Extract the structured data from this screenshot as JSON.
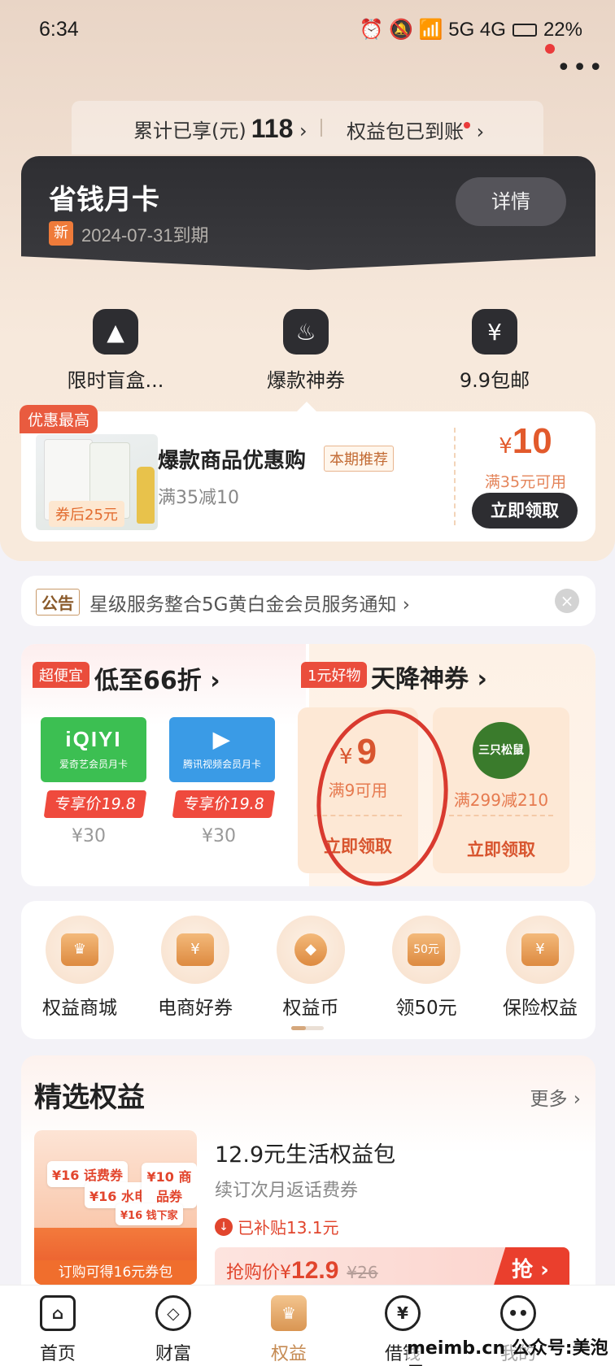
{
  "status": {
    "time": "6:34",
    "icons": "⏰ 🔕 📶 5G 4G",
    "battery": "22%"
  },
  "top": {
    "more": "•••",
    "stats_label": "累计已享(元)",
    "stats_value": "118",
    "benefit_arrived": "权益包已到账"
  },
  "card": {
    "title": "省钱月卡",
    "new_badge": "新",
    "expire": "2024-07-31到期",
    "detail_button": "详情"
  },
  "quick": [
    {
      "label": "限时盲盒...",
      "icon": "image-icon"
    },
    {
      "label": "爆款神券",
      "icon": "fire-icon"
    },
    {
      "label": "9.9包邮",
      "icon": "money-bag-icon"
    }
  ],
  "promo": {
    "tag": "优惠最高",
    "after": "券后25元",
    "title": "爆款商品优惠购",
    "recommend": "本期推荐",
    "sub": "满35减10",
    "price_symbol": "¥",
    "price": "10",
    "condition": "满35元可用",
    "claim": "立即领取"
  },
  "notice": {
    "tag": "公告",
    "text": "星级服务整合5G黄白金会员服务通知 ›",
    "close": "×"
  },
  "deals": {
    "left_pill": "超便宜",
    "left_title": "低至66折 ›",
    "right_pill": "1元好物",
    "right_title": "天降神券 ›",
    "vips": [
      {
        "logo": "iQIYI",
        "caption": "爱奇艺会员月卡",
        "exclusive": "专享价19.8",
        "orig": "¥30",
        "color": "#3cbf52"
      },
      {
        "logo": "▶",
        "caption": "腾讯视频会员月卡",
        "exclusive": "专享价19.8",
        "orig": "¥30",
        "color": "#3a9be6"
      }
    ],
    "coupons": [
      {
        "symbol": "¥",
        "value": "9",
        "cond": "满9可用",
        "btn": "立即领取"
      },
      {
        "logo": "三只松鼠",
        "cond": "满299减210",
        "btn": "立即领取"
      }
    ]
  },
  "grid": [
    {
      "label": "权益商城",
      "glyph": "♛"
    },
    {
      "label": "电商好券",
      "glyph": "¥"
    },
    {
      "label": "权益币",
      "glyph": "◆"
    },
    {
      "label": "领50元",
      "glyph": "50元"
    },
    {
      "label": "保险权益",
      "glyph": "¥"
    }
  ],
  "featured": {
    "title": "精选权益",
    "more": "更多 ›",
    "img_chips": [
      "¥16 话费券",
      "¥16 水电煤",
      "¥10 商品券",
      "¥16 钱下家"
    ],
    "img_bar": "订购可得16元券包",
    "name": "12.9元生活权益包",
    "sub": "续订次月返话费券",
    "subsidy": "已补贴13.1元",
    "buy_label": "抢购价",
    "buy_symbol": "¥",
    "buy_price": "12.9",
    "buy_orig": "¥26",
    "grab": "抢 ›"
  },
  "tabs": [
    {
      "label": "首页",
      "glyph": "⌂"
    },
    {
      "label": "财富",
      "glyph": "◇"
    },
    {
      "label": "权益",
      "glyph": "♛"
    },
    {
      "label": "借钱",
      "glyph": "¥"
    },
    {
      "label": "我的",
      "glyph": "••"
    }
  ],
  "watermark": "meimb.cn 公众号:美泡君"
}
